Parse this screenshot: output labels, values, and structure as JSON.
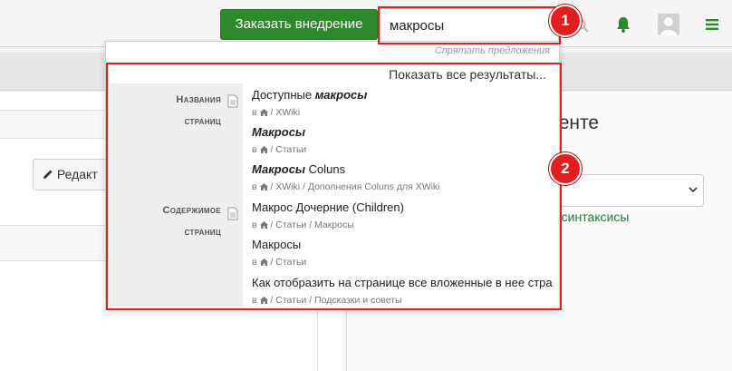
{
  "header": {
    "order_button": "Заказать внедрение",
    "search_value": "макросы"
  },
  "page": {
    "edit_button": "Редакт",
    "panel_title": "ументе",
    "syntax_link": "е синтаксисы"
  },
  "suggestions": {
    "hide_link": "Спрятать предложения",
    "show_all": "Показать все результаты...",
    "categories": [
      {
        "line1": "Названия",
        "line2": "страниц"
      },
      {
        "line1": "Содержимое",
        "line2": "страниц"
      }
    ],
    "results": [
      {
        "pre": "Доступные ",
        "hl": "макросы",
        "post": "",
        "path_prefix": "в",
        "path": "/ XWiki"
      },
      {
        "pre": "",
        "hl": "Макросы",
        "post": "",
        "path_prefix": "в",
        "path": "/ Статьи"
      },
      {
        "pre": "",
        "hl": "Макросы",
        "post": " Coluns",
        "path_prefix": "в",
        "path": "/ XWiki / Дополнения Coluns для XWiki"
      },
      {
        "pre": "Макрос Дочерние (Children)",
        "hl": "",
        "post": "",
        "path_prefix": "в",
        "path": "/ Статьи / Макросы"
      },
      {
        "pre": "Макросы",
        "hl": "",
        "post": "",
        "path_prefix": "в",
        "path": "/ Статьи"
      },
      {
        "pre": "Как отобразить на странице все вложенные в нее стра",
        "hl": "",
        "post": "",
        "path_prefix": "в",
        "path": "/ Статьи / Подсказки и советы"
      }
    ]
  },
  "annotations": {
    "badge1": "1",
    "badge2": "2"
  },
  "colors": {
    "primary_green": "#2c8a2c",
    "annotation_red": "#e41e1e"
  },
  "icons": [
    "search-icon",
    "bell-icon",
    "avatar",
    "menu-icon",
    "document-icon",
    "home-icon",
    "pencil-icon",
    "chevron-down-icon"
  ]
}
